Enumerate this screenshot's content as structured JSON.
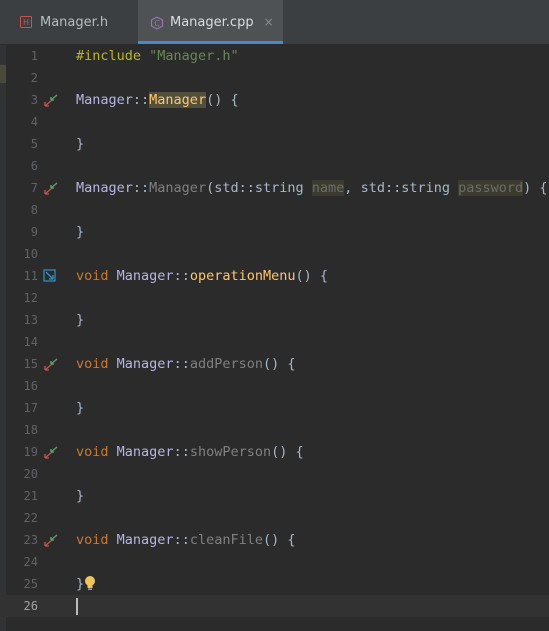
{
  "tabs": [
    {
      "label": "Manager.h",
      "icon": "header-file-icon",
      "active": false
    },
    {
      "label": "Manager.cpp",
      "icon": "cpp-file-icon",
      "active": true,
      "close": "×"
    }
  ],
  "lines": [
    {
      "n": "1"
    },
    {
      "n": "2"
    },
    {
      "n": "3"
    },
    {
      "n": "4"
    },
    {
      "n": "5"
    },
    {
      "n": "6"
    },
    {
      "n": "7"
    },
    {
      "n": "8"
    },
    {
      "n": "9"
    },
    {
      "n": "10"
    },
    {
      "n": "11"
    },
    {
      "n": "12"
    },
    {
      "n": "13"
    },
    {
      "n": "14"
    },
    {
      "n": "15"
    },
    {
      "n": "16"
    },
    {
      "n": "17"
    },
    {
      "n": "18"
    },
    {
      "n": "19"
    },
    {
      "n": "20"
    },
    {
      "n": "21"
    },
    {
      "n": "22"
    },
    {
      "n": "23"
    },
    {
      "n": "24"
    },
    {
      "n": "25"
    },
    {
      "n": "26"
    }
  ],
  "code": {
    "l1": {
      "directive": "#include",
      "path": "\"Manager.h\""
    },
    "l3": {
      "cls": "Manager",
      "sep": "::",
      "name": "Manager",
      "rest": "() {"
    },
    "l5": {
      "text": "}"
    },
    "l7": {
      "cls": "Manager",
      "sep": "::",
      "name": "Manager",
      "open": "(",
      "type1": "std::string",
      "p1": "name",
      "comma": ",",
      "type2": "std::string",
      "p2": "password",
      "rest": ") {"
    },
    "l9": {
      "text": "}"
    },
    "l11": {
      "kw": "void",
      "cls": "Manager",
      "sep": "::",
      "name": "operationMenu",
      "rest": "() {"
    },
    "l13": {
      "text": "}"
    },
    "l15": {
      "kw": "void",
      "cls": "Manager",
      "sep": "::",
      "name": "addPerson",
      "rest": "() {"
    },
    "l17": {
      "text": "}"
    },
    "l19": {
      "kw": "void",
      "cls": "Manager",
      "sep": "::",
      "name": "showPerson",
      "rest": "() {"
    },
    "l21": {
      "text": "}"
    },
    "l23": {
      "kw": "void",
      "cls": "Manager",
      "sep": "::",
      "name": "cleanFile",
      "rest": "() {"
    },
    "l25": {
      "text": "}"
    }
  },
  "colors": {
    "background": "#2b2b2b",
    "tab_accent": "#4a88c7",
    "keyword": "#cc7832",
    "function": "#ffc66d",
    "string": "#6a8759"
  }
}
